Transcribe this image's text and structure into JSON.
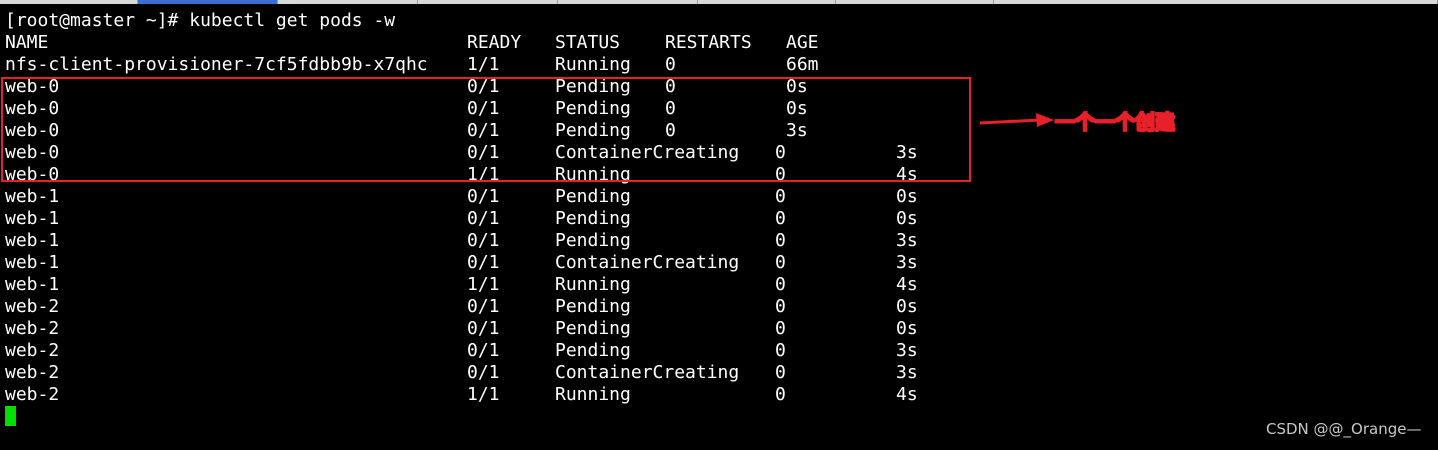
{
  "terminal": {
    "prompt_line": "[root@master ~]# kubectl get pods -w",
    "header": {
      "name": "NAME",
      "ready": "READY",
      "status": "STATUS",
      "restarts": "RESTARTS",
      "age": "AGE"
    },
    "rows": [
      {
        "name": "nfs-client-provisioner-7cf5fdbb9b-x7qhc",
        "ready": "1/1",
        "status": "Running",
        "restarts": "0",
        "age": "66m"
      },
      {
        "name": "web-0",
        "ready": "0/1",
        "status": "Pending",
        "restarts": "0",
        "age": "0s"
      },
      {
        "name": "web-0",
        "ready": "0/1",
        "status": "Pending",
        "restarts": "0",
        "age": "0s"
      },
      {
        "name": "web-0",
        "ready": "0/1",
        "status": "Pending",
        "restarts": "0",
        "age": "3s"
      },
      {
        "name": "web-0",
        "ready": "0/1",
        "status": "ContainerCreating",
        "restarts": "0",
        "age": "3s"
      },
      {
        "name": "web-0",
        "ready": "1/1",
        "status": "Running",
        "restarts": "0",
        "age": "4s"
      },
      {
        "name": "web-1",
        "ready": "0/1",
        "status": "Pending",
        "restarts": "0",
        "age": "0s"
      },
      {
        "name": "web-1",
        "ready": "0/1",
        "status": "Pending",
        "restarts": "0",
        "age": "0s"
      },
      {
        "name": "web-1",
        "ready": "0/1",
        "status": "Pending",
        "restarts": "0",
        "age": "3s"
      },
      {
        "name": "web-1",
        "ready": "0/1",
        "status": "ContainerCreating",
        "restarts": "0",
        "age": "3s"
      },
      {
        "name": "web-1",
        "ready": "1/1",
        "status": "Running",
        "restarts": "0",
        "age": "4s"
      },
      {
        "name": "web-2",
        "ready": "0/1",
        "status": "Pending",
        "restarts": "0",
        "age": "0s"
      },
      {
        "name": "web-2",
        "ready": "0/1",
        "status": "Pending",
        "restarts": "0",
        "age": "0s"
      },
      {
        "name": "web-2",
        "ready": "0/1",
        "status": "Pending",
        "restarts": "0",
        "age": "3s"
      },
      {
        "name": "web-2",
        "ready": "0/1",
        "status": "ContainerCreating",
        "restarts": "0",
        "age": "3s"
      },
      {
        "name": "web-2",
        "ready": "1/1",
        "status": "Running",
        "restarts": "0",
        "age": "4s"
      }
    ]
  },
  "annotation": {
    "text": "一个一个创建",
    "color": "#e8202a"
  },
  "watermark": {
    "text": "CSDN @@_Orange—"
  },
  "colors": {
    "background": "#000000",
    "foreground": "#ffffff",
    "cursor": "#00e000",
    "highlight": "#e8202a"
  }
}
